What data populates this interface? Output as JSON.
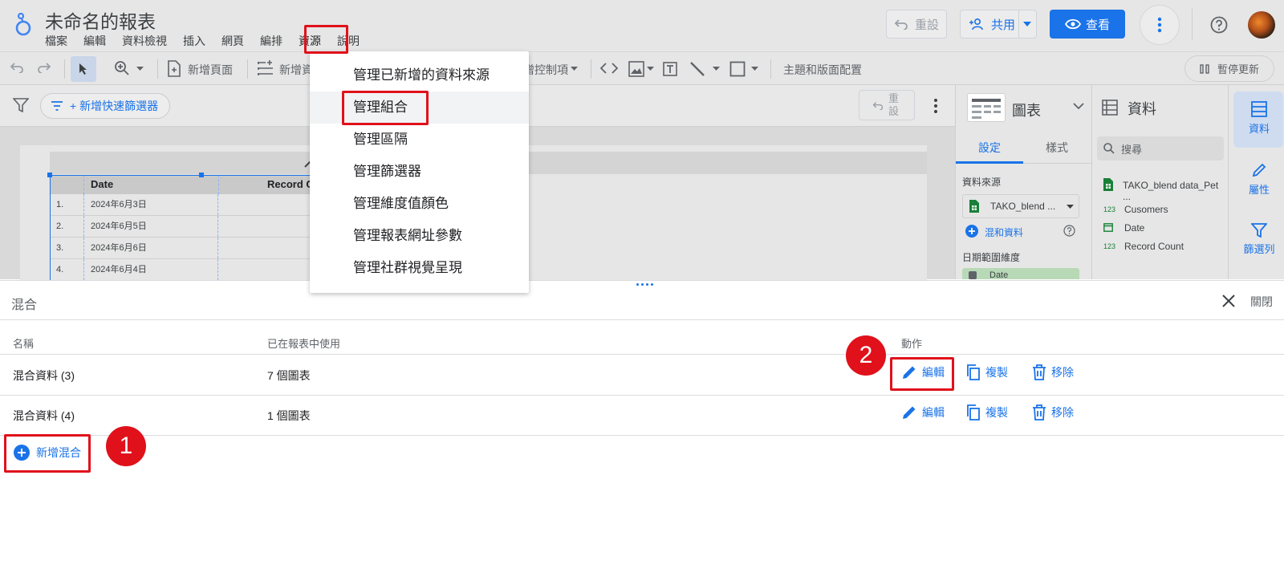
{
  "app": {
    "title": "未命名的報表",
    "menu": [
      "檔案",
      "編輯",
      "資料檢視",
      "插入",
      "網頁",
      "編排",
      "資源",
      "說明"
    ],
    "reset_label": "重設",
    "share_label": "共用",
    "view_label": "查看"
  },
  "toolbar": {
    "add_page": "新增頁面",
    "add_data_partial": "新增資",
    "controls_partial": "增控制項",
    "theme_layout": "主題和版面配置",
    "pause_update": "暫停更新"
  },
  "filterbar": {
    "quick_filter": "+ 新增快速篩選器",
    "reset": "重設"
  },
  "table": {
    "headers": [
      "Date",
      "Record C"
    ],
    "rows": [
      {
        "num": "1.",
        "date": "2024年6月3日"
      },
      {
        "num": "2.",
        "date": "2024年6月5日"
      },
      {
        "num": "3.",
        "date": "2024年6月6日"
      },
      {
        "num": "4.",
        "date": "2024年6月4日"
      }
    ]
  },
  "props_panel": {
    "chart_label": "圖表",
    "tab_setup": "設定",
    "tab_style": "樣式",
    "data_source_label": "資料來源",
    "data_source_value": "TAKO_blend ...",
    "blend_data": "混和資料",
    "date_range_label": "日期範圍維度",
    "date_chip": "Date"
  },
  "data_panel": {
    "title": "資料",
    "search_placeholder": "搜尋",
    "source_name": "TAKO_blend data_Pet ...",
    "fields": [
      {
        "type": "123",
        "name": "Cusomers"
      },
      {
        "type": "date",
        "name": "Date"
      },
      {
        "type": "123",
        "name": "Record Count"
      }
    ]
  },
  "side_rail": {
    "data": "資料",
    "properties": "屬性",
    "filter": "篩選列"
  },
  "dropdown": {
    "items": [
      "管理已新增的資料來源",
      "管理組合",
      "管理區隔",
      "管理篩選器",
      "管理維度值顏色",
      "管理報表網址參數",
      "管理社群視覺呈現"
    ]
  },
  "bottom_panel": {
    "title": "混合",
    "close_label": "關閉",
    "columns": {
      "name": "名稱",
      "used": "已在報表中使用",
      "actions": "動作"
    },
    "rows": [
      {
        "name": "混合資料 (3)",
        "used": "7 個圖表"
      },
      {
        "name": "混合資料 (4)",
        "used": "1 個圖表"
      }
    ],
    "action_edit": "編輯",
    "action_copy": "複製",
    "action_remove": "移除",
    "add_blend": "新增混合"
  },
  "annotations": {
    "step1": "1",
    "step2": "2"
  },
  "colors": {
    "accent": "#1a73e8",
    "highlight": "#e0111b",
    "green": "#188038"
  }
}
